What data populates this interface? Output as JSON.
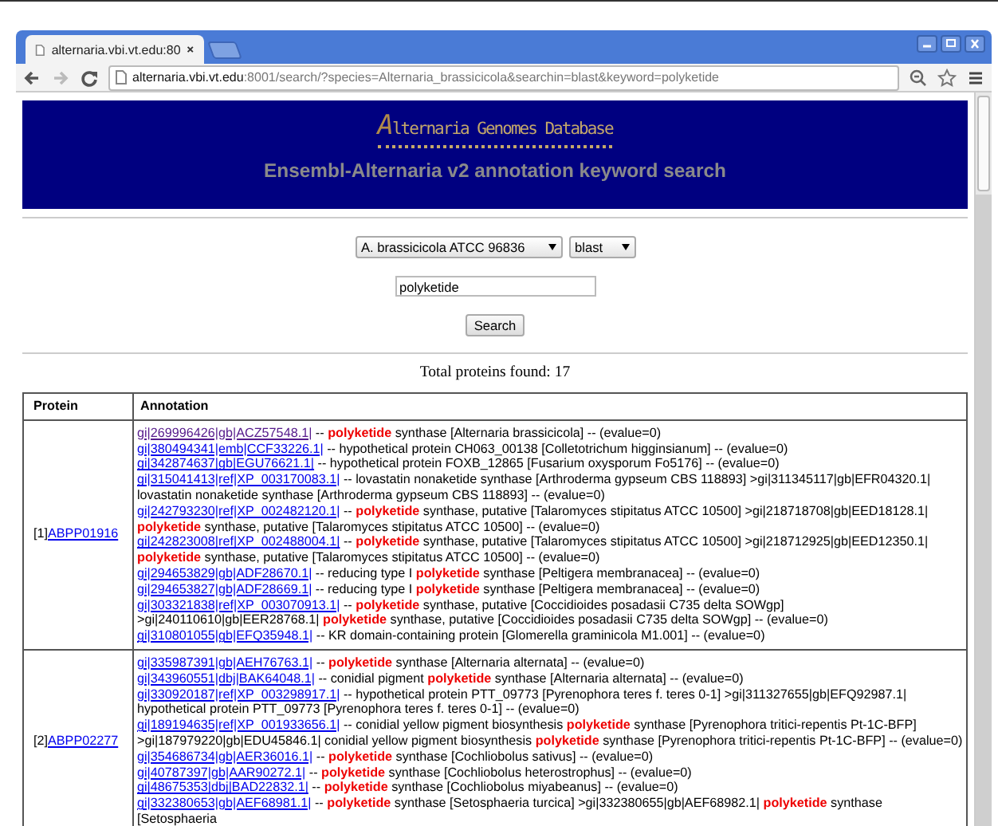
{
  "browser": {
    "tabs": [
      {
        "title": "alternaria.vbi.vt.edu:80",
        "selected": true
      }
    ],
    "address": {
      "host": "alternaria.vbi.vt.edu",
      "path": ":8001/search/?species=Alternaria_brassicicola&searchin=blast&keyword=polyketide"
    }
  },
  "header": {
    "logo": "Alternaria Genomes Database",
    "subtitle": "Ensembl-Alternaria v2 annotation keyword search"
  },
  "form": {
    "species": "A. brassicicola ATCC 96836",
    "search_in": "blast",
    "keyword": "polyketide",
    "button": "Search"
  },
  "total": "Total proteins found: 17",
  "table": {
    "columns": [
      "Protein",
      "Annotation"
    ],
    "rows": [
      {
        "index": "[1]",
        "protein": "ABPP01916",
        "annotations": [
          {
            "link": "gi|269996426|gb|ACZ57548.1|",
            "visited": true,
            "text": " -- **polyketide** synthase [Alternaria brassicicola] -- (evalue=0)"
          },
          {
            "link": "gi|380494341|emb|CCF33226.1|",
            "visited": false,
            "text": " -- hypothetical protein CH063_00138 [Colletotrichum higginsianum] -- (evalue=0)"
          },
          {
            "link": "gi|342874637|gb|EGU76621.1|",
            "visited": false,
            "text": " -- hypothetical protein FOXB_12865 [Fusarium oxysporum Fo5176] -- (evalue=0)"
          },
          {
            "link": "gi|315041413|ref|XP_003170083.1|",
            "visited": false,
            "text": " -- lovastatin nonaketide synthase [Arthroderma gypseum CBS 118893] >gi|311345117|gb|EFR04320.1| lovastatin nonaketide synthase [Arthroderma gypseum CBS 118893] -- (evalue=0)"
          },
          {
            "link": "gi|242793230|ref|XP_002482120.1|",
            "visited": false,
            "text": " -- **polyketide** synthase, putative [Talaromyces stipitatus ATCC 10500] >gi|218718708|gb|EED18128.1| **polyketide** synthase, putative [Talaromyces stipitatus ATCC 10500] -- (evalue=0)"
          },
          {
            "link": "gi|242823008|ref|XP_002488004.1|",
            "visited": false,
            "text": " -- **polyketide** synthase, putative [Talaromyces stipitatus ATCC 10500] >gi|218712925|gb|EED12350.1| **polyketide** synthase, putative [Talaromyces stipitatus ATCC 10500] -- (evalue=0)"
          },
          {
            "link": "gi|294653829|gb|ADF28670.1|",
            "visited": false,
            "text": " -- reducing type I **polyketide** synthase [Peltigera membranacea] -- (evalue=0)"
          },
          {
            "link": "gi|294653827|gb|ADF28669.1|",
            "visited": false,
            "text": " -- reducing type I **polyketide** synthase [Peltigera membranacea] -- (evalue=0)"
          },
          {
            "link": "gi|303321838|ref|XP_003070913.1|",
            "visited": false,
            "text": " -- **polyketide** synthase, putative [Coccidioides posadasii C735 delta SOWgp] >gi|240110610|gb|EER28768.1| **polyketide** synthase, putative [Coccidioides posadasii C735 delta SOWgp] -- (evalue=0)"
          },
          {
            "link": "gi|310801055|gb|EFQ35948.1|",
            "visited": false,
            "text": " -- KR domain-containing protein [Glomerella graminicola M1.001] -- (evalue=0)"
          }
        ]
      },
      {
        "index": "[2]",
        "protein": "ABPP02277",
        "annotations": [
          {
            "link": "gi|335987391|gb|AEH76763.1|",
            "visited": false,
            "text": " -- **polyketide** synthase [Alternaria alternata] -- (evalue=0)"
          },
          {
            "link": "gi|343960551|dbj|BAK64048.1|",
            "visited": false,
            "text": " -- conidial pigment **polyketide** synthase [Alternaria alternata] -- (evalue=0)"
          },
          {
            "link": "gi|330920187|ref|XP_003298917.1|",
            "visited": false,
            "text": " -- hypothetical protein PTT_09773 [Pyrenophora teres f. teres 0-1] >gi|311327655|gb|EFQ92987.1| hypothetical protein PTT_09773 [Pyrenophora teres f. teres 0-1] -- (evalue=0)"
          },
          {
            "link": "gi|189194635|ref|XP_001933656.1|",
            "visited": false,
            "text": " -- conidial yellow pigment biosynthesis **polyketide** synthase [Pyrenophora tritici-repentis Pt-1C-BFP] >gi|187979220|gb|EDU45846.1| conidial yellow pigment biosynthesis **polyketide** synthase [Pyrenophora tritici-repentis Pt-1C-BFP] -- (evalue=0)"
          },
          {
            "link": "gi|354686734|gb|AER36016.1|",
            "visited": false,
            "text": " -- **polyketide** synthase [Cochliobolus sativus] -- (evalue=0)"
          },
          {
            "link": "gi|40787397|gb|AAR90272.1|",
            "visited": false,
            "text": " -- **polyketide** synthase [Cochliobolus heterostrophus] -- (evalue=0)"
          },
          {
            "link": "gi|48675353|dbj|BAD22832.1|",
            "visited": false,
            "text": " -- **polyketide** synthase [Cochliobolus miyabeanus] -- (evalue=0)"
          },
          {
            "link": "gi|332380653|gb|AEF68981.1|",
            "visited": false,
            "text": " -- **polyketide** synthase [Setosphaeria turcica] >gi|332380655|gb|AEF68982.1| **polyketide** synthase [Setosphaeria"
          }
        ]
      }
    ]
  }
}
